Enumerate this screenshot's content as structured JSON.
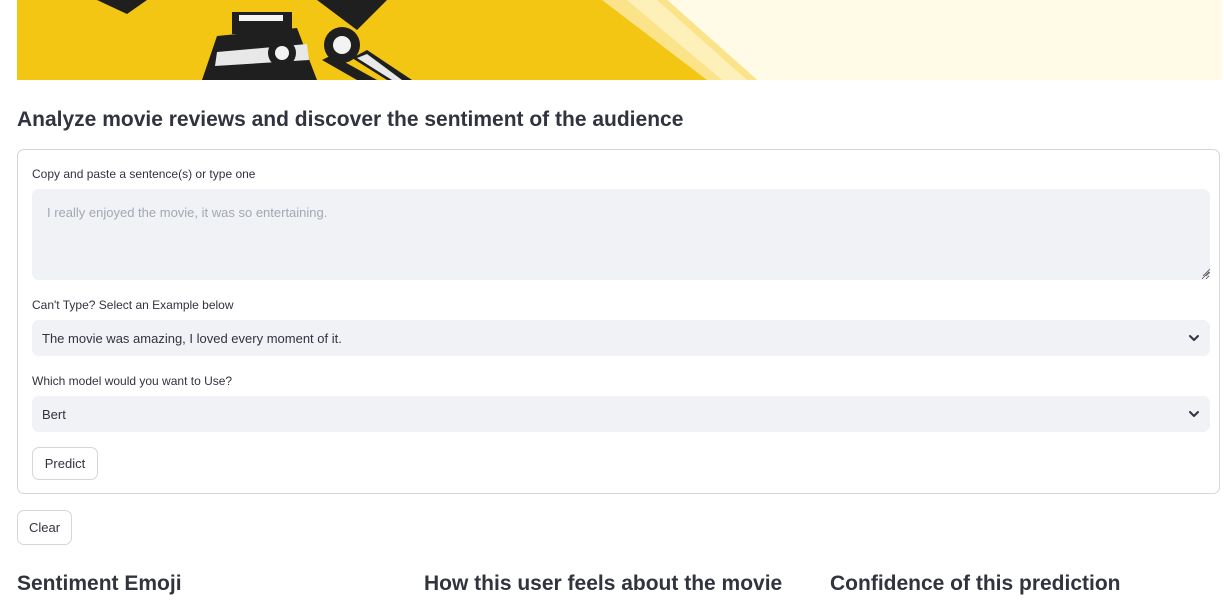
{
  "banner": {
    "colors": {
      "primary": "#f3c614",
      "light": "#fffbe6",
      "ray": "#fbe38a",
      "ink": "#1f1f1f"
    },
    "image_name": "film-camera-banner"
  },
  "page_title": "Analyze movie reviews and discover the sentiment of the audience",
  "form": {
    "text_label": "Copy and paste a sentence(s) or type one",
    "text_placeholder": "I really enjoyed the movie, it was so entertaining.",
    "text_value": "",
    "example_label": "Can't Type? Select an Example below",
    "example_selected": "The movie was amazing, I loved every moment of it.",
    "model_label": "Which model would you want to Use?",
    "model_selected": "Bert",
    "predict_label": "Predict"
  },
  "clear_label": "Clear",
  "results": {
    "col1_heading": "Sentiment Emoji",
    "col2_heading": "How this user feels about the movie",
    "col3_heading": "Confidence of this prediction"
  },
  "icons": {
    "select_chevron": "chevron-down-icon",
    "resize": "resize-grip-icon"
  }
}
